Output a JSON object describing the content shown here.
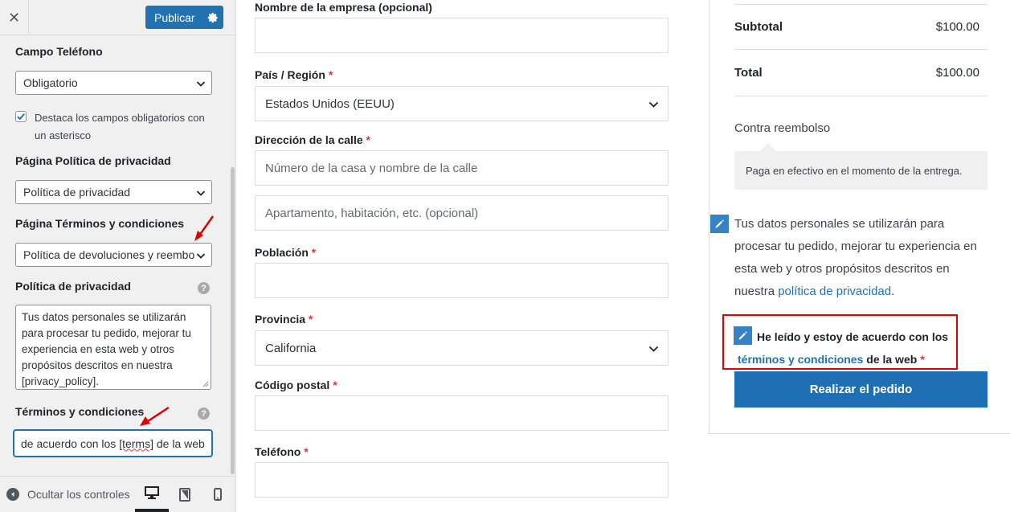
{
  "panel": {
    "close_icon": "close-icon",
    "publish_label": "Publicar",
    "settings_icon": "gear-icon",
    "phone_field": {
      "label": "Campo Teléfono",
      "value": "Obligatorio"
    },
    "highlight_required": {
      "checked": true,
      "label": "Destaca los campos obligatorios con un asterisco"
    },
    "privacy_page": {
      "label": "Página Política de privacidad",
      "value": "Política de privacidad"
    },
    "terms_page": {
      "label": "Página Términos y condiciones",
      "value": "Política de devoluciones y reembo"
    },
    "privacy_policy": {
      "label": "Política de privacidad",
      "text": "Tus datos personales se utilizarán para procesar tu pedido, mejorar tu experiencia en esta web y otros propósitos descritos en nuestra [privacy_policy]."
    },
    "terms": {
      "label": "Términos y condiciones",
      "value_before": "de acuerdo con los ",
      "value_word": "[terms]",
      "value_after": " de la web"
    },
    "help_glyph": "?",
    "footer": {
      "collapse_label": "Ocultar los controles",
      "devices": [
        "desktop-icon",
        "tablet-icon",
        "mobile-icon"
      ]
    }
  },
  "form": {
    "required_mark": "*",
    "company": {
      "label": "Nombre de la empresa (opcional)",
      "value": ""
    },
    "country": {
      "label": "País / Región",
      "value": "Estados Unidos (EEUU)"
    },
    "street": {
      "label": "Dirección de la calle",
      "placeholder1": "Número de la casa y nombre de la calle",
      "placeholder2": "Apartamento, habitación, etc. (opcional)"
    },
    "city": {
      "label": "Población",
      "value": ""
    },
    "state": {
      "label": "Provincia",
      "value": "California"
    },
    "postcode": {
      "label": "Código postal",
      "value": ""
    },
    "phone": {
      "label": "Teléfono",
      "value": ""
    }
  },
  "order": {
    "subtotal_label": "Subtotal",
    "subtotal_value": "$100.00",
    "total_label": "Total",
    "total_value": "$100.00",
    "payment_method": "Contra reembolso",
    "payment_description": "Paga en efectivo en el momento de la entrega.",
    "privacy_text": "Tus datos personales se utilizarán para procesar tu pedido, mejorar tu experiencia en esta web y otros propósitos descritos en nuestra ",
    "privacy_link": "política de privacidad",
    "privacy_end": ".",
    "terms_text_before": "He leído y estoy de acuerdo con los ",
    "terms_link": "términos y condiciones",
    "terms_text_after": " de la web ",
    "place_order_label": "Realizar el pedido"
  },
  "colors": {
    "accent": "#2271b1",
    "annotation": "#e00000",
    "required": "#d63638"
  }
}
